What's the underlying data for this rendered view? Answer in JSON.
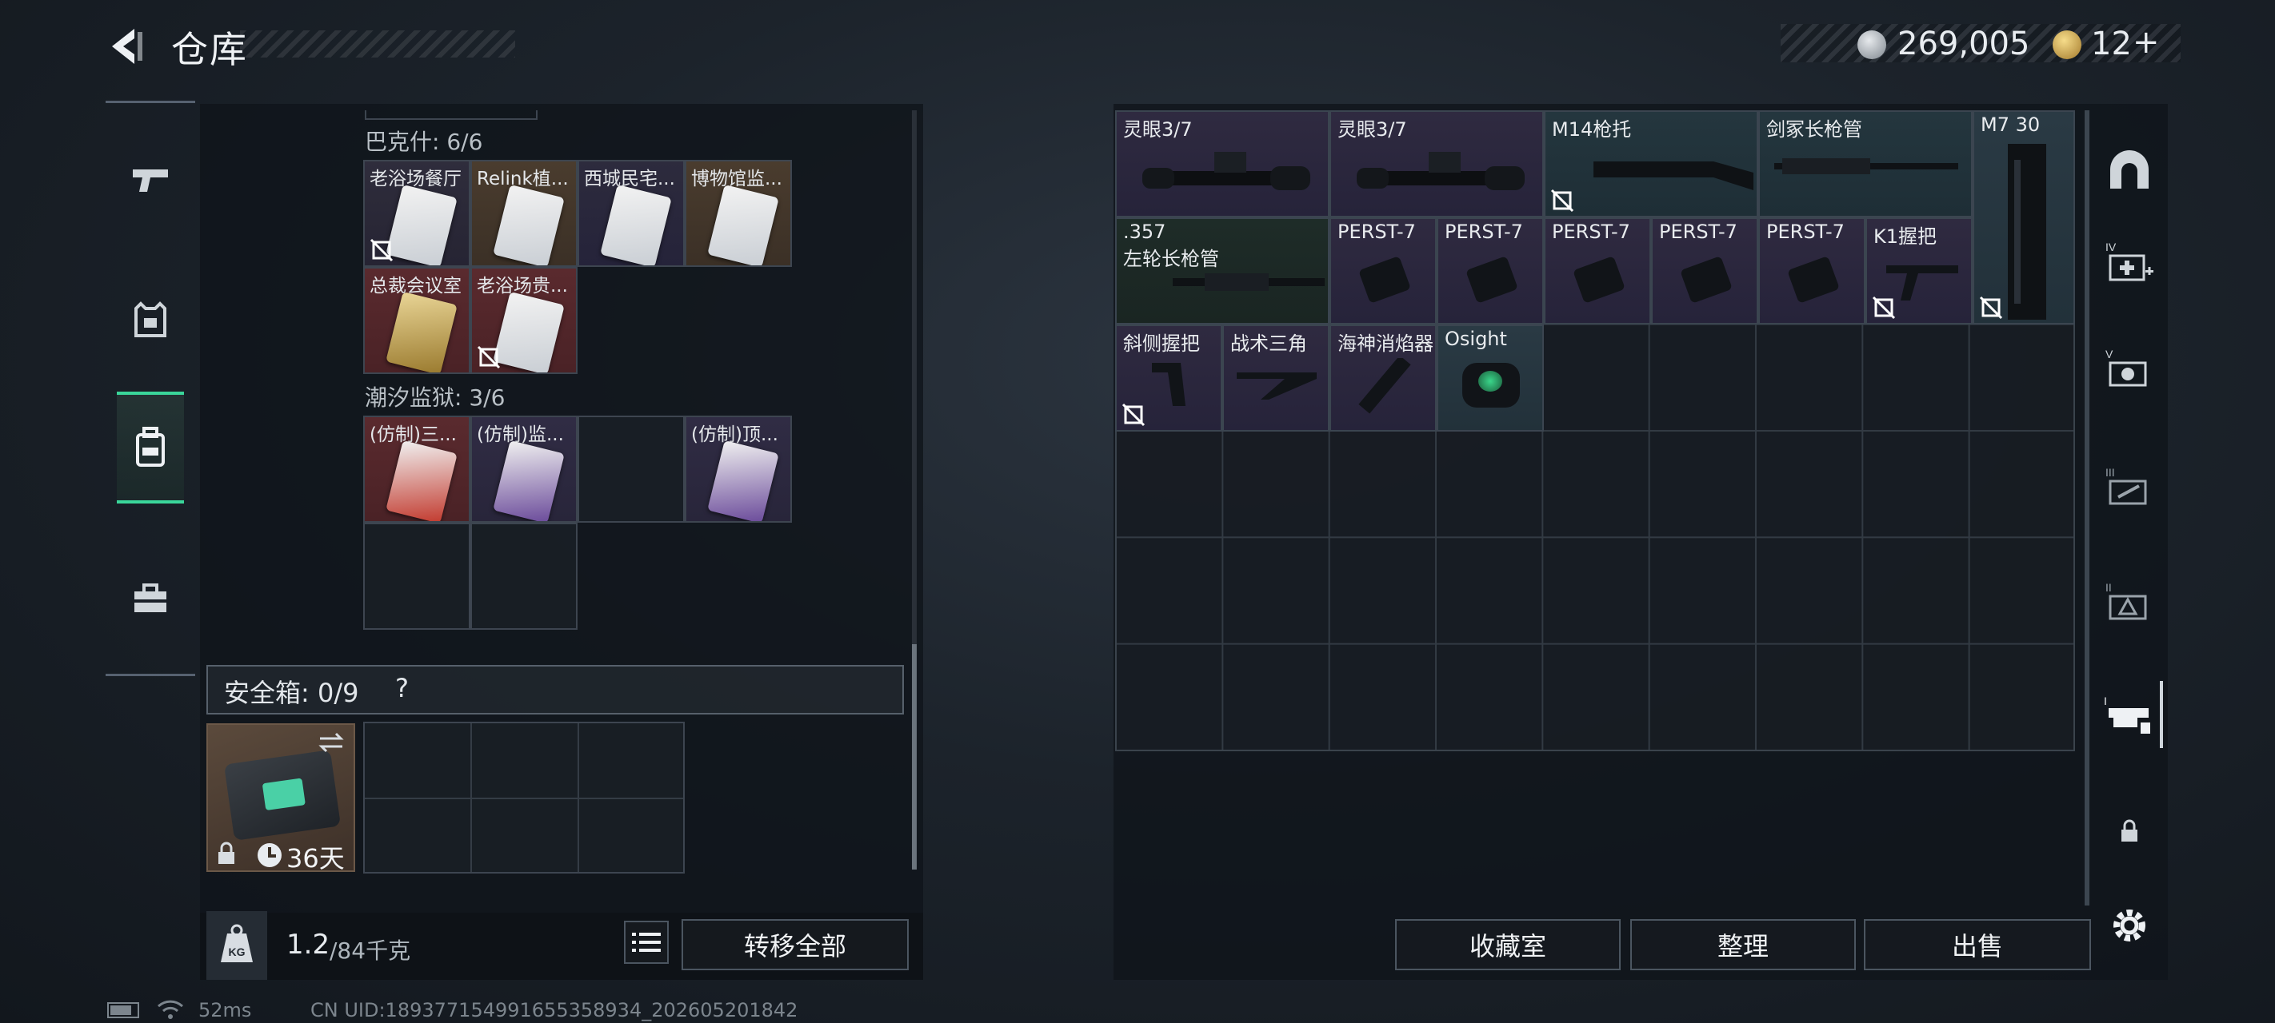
{
  "header": {
    "title": "仓库",
    "currency": {
      "coins": "269,005",
      "tickets": "12",
      "plus": "+"
    }
  },
  "left_nav": {
    "items": [
      "pistol",
      "armor",
      "backpack",
      "case"
    ],
    "active": 2
  },
  "containers": [
    {
      "label": "巴克什: 6/6",
      "cards": [
        "老浴场餐厅",
        "Relink植...",
        "西城民宅...",
        "博物馆监...",
        "总裁会议室",
        "老浴场贵..."
      ]
    },
    {
      "label": "潮汐监狱: 3/6",
      "cards": [
        "(仿制)三...",
        "(仿制)监...",
        "(仿制)顶..."
      ]
    }
  ],
  "safe_box": {
    "label": "安全箱: 0/9",
    "help": "?",
    "duration": "36天"
  },
  "weight": {
    "current": "1.2",
    "max": "/84千克"
  },
  "transfer_all": "转移全部",
  "stash_items": [
    {
      "name": "灵眼3/7"
    },
    {
      "name": "灵眼3/7"
    },
    {
      "name": "M14枪托"
    },
    {
      "name": "剑冢长枪管"
    },
    {
      "name": "M7 30"
    },
    {
      "name": ".357",
      "name2": "左轮长枪管"
    },
    {
      "name": "PERST-7"
    },
    {
      "name": "PERST-7"
    },
    {
      "name": "PERST-7"
    },
    {
      "name": "PERST-7"
    },
    {
      "name": "PERST-7"
    },
    {
      "name": "K1握把"
    },
    {
      "name": "斜侧握把"
    },
    {
      "name": "战术三角"
    },
    {
      "name": "海神消焰器"
    },
    {
      "name": "Osight"
    }
  ],
  "bottom_buttons": {
    "collection": "收藏室",
    "sort": "整理",
    "sell": "出售"
  },
  "status_bar": {
    "ping": "52ms",
    "uid": "CN UID:18937715499165535893​4_202605201842"
  },
  "colors": {
    "accent": "#3ad69a",
    "card_tan": "#6b5640",
    "card_red": "#5a2a2e",
    "card_purple": "#2f2a40"
  }
}
